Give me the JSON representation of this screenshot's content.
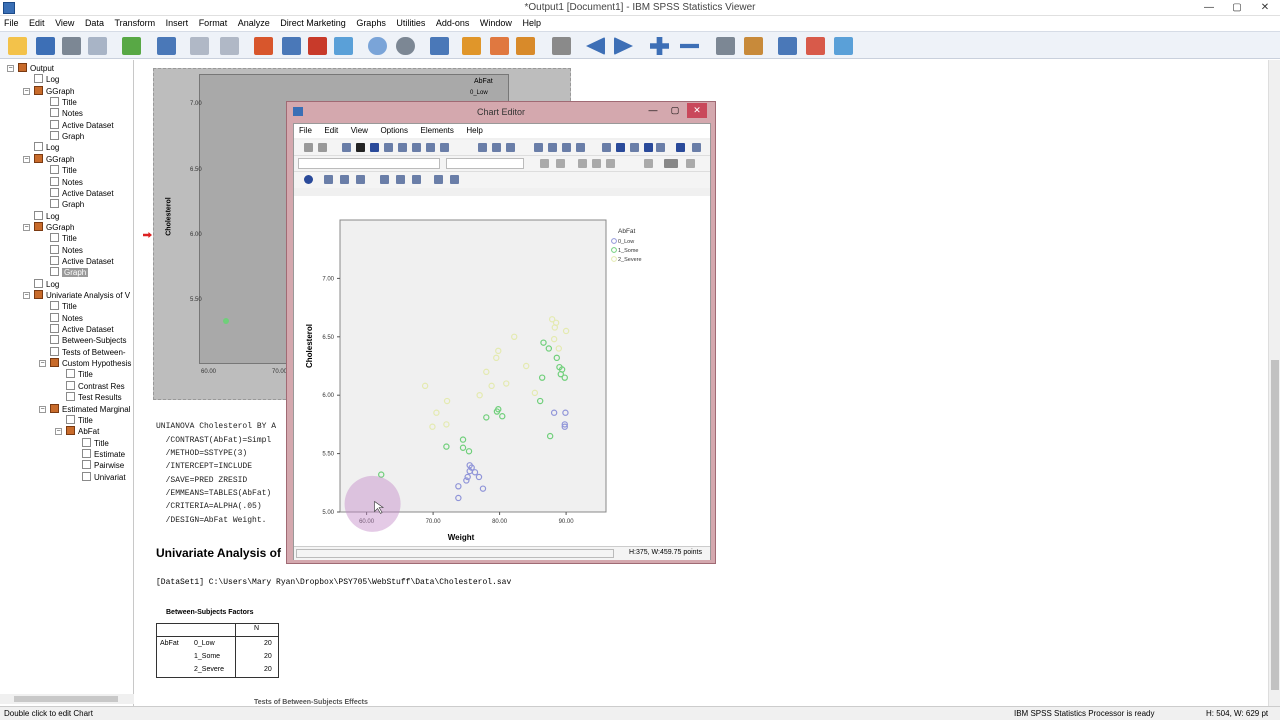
{
  "window": {
    "title": "*Output1 [Document1] - IBM SPSS Statistics Viewer",
    "min": "—",
    "max": "▢",
    "close": "✕"
  },
  "menu": [
    "File",
    "Edit",
    "View",
    "Data",
    "Transform",
    "Insert",
    "Format",
    "Analyze",
    "Direct Marketing",
    "Graphs",
    "Utilities",
    "Add-ons",
    "Window",
    "Help"
  ],
  "outline": [
    {
      "label": "Output",
      "level": 0,
      "icon": "book"
    },
    {
      "label": "Log",
      "level": 1,
      "icon": "doc"
    },
    {
      "label": "GGraph",
      "level": 1,
      "icon": "book"
    },
    {
      "label": "Title",
      "level": 2,
      "icon": "doc"
    },
    {
      "label": "Notes",
      "level": 2,
      "icon": "doc"
    },
    {
      "label": "Active Dataset",
      "level": 2,
      "icon": "doc"
    },
    {
      "label": "Graph",
      "level": 2,
      "icon": "doc"
    },
    {
      "label": "Log",
      "level": 1,
      "icon": "doc"
    },
    {
      "label": "GGraph",
      "level": 1,
      "icon": "book"
    },
    {
      "label": "Title",
      "level": 2,
      "icon": "doc"
    },
    {
      "label": "Notes",
      "level": 2,
      "icon": "doc"
    },
    {
      "label": "Active Dataset",
      "level": 2,
      "icon": "doc"
    },
    {
      "label": "Graph",
      "level": 2,
      "icon": "doc"
    },
    {
      "label": "Log",
      "level": 1,
      "icon": "doc"
    },
    {
      "label": "GGraph",
      "level": 1,
      "icon": "book"
    },
    {
      "label": "Title",
      "level": 2,
      "icon": "doc"
    },
    {
      "label": "Notes",
      "level": 2,
      "icon": "doc"
    },
    {
      "label": "Active Dataset",
      "level": 2,
      "icon": "doc"
    },
    {
      "label": "Graph",
      "level": 2,
      "icon": "doc",
      "selected": true
    },
    {
      "label": "Log",
      "level": 1,
      "icon": "doc"
    },
    {
      "label": "Univariate Analysis of V",
      "level": 1,
      "icon": "book"
    },
    {
      "label": "Title",
      "level": 2,
      "icon": "doc"
    },
    {
      "label": "Notes",
      "level": 2,
      "icon": "doc"
    },
    {
      "label": "Active Dataset",
      "level": 2,
      "icon": "doc"
    },
    {
      "label": "Between-Subjects",
      "level": 2,
      "icon": "doc"
    },
    {
      "label": "Tests of Between-",
      "level": 2,
      "icon": "doc"
    },
    {
      "label": "Custom Hypothesis",
      "level": 2,
      "icon": "book"
    },
    {
      "label": "Title",
      "level": 3,
      "icon": "doc"
    },
    {
      "label": "Contrast Res",
      "level": 3,
      "icon": "doc"
    },
    {
      "label": "Test Results",
      "level": 3,
      "icon": "doc"
    },
    {
      "label": "Estimated Marginal",
      "level": 2,
      "icon": "book"
    },
    {
      "label": "Title",
      "level": 3,
      "icon": "doc"
    },
    {
      "label": "AbFat",
      "level": 3,
      "icon": "book"
    },
    {
      "label": "Title",
      "level": 4,
      "icon": "doc"
    },
    {
      "label": "Estimate",
      "level": 4,
      "icon": "doc"
    },
    {
      "label": "Pairwise",
      "level": 4,
      "icon": "doc"
    },
    {
      "label": "Univariat",
      "level": 4,
      "icon": "doc"
    }
  ],
  "bgchart": {
    "ylabel": "Cholesterol",
    "yticks": [
      "7.00",
      "6.50",
      "6.00",
      "5.50"
    ],
    "xticks": [
      "60.00",
      "70.00"
    ],
    "legend_title": "AbFat",
    "legend_first": "0_Low"
  },
  "syntax": [
    "UNIANOVA Cholesterol BY A",
    "  /CONTRAST(AbFat)=Simpl",
    "  /METHOD=SSTYPE(3)",
    "  /INTERCEPT=INCLUDE",
    "  /SAVE=PRED ZRESID",
    "  /EMMEANS=TABLES(AbFat)",
    "  /CRITERIA=ALPHA(.05)",
    "  /DESIGN=AbFat Weight."
  ],
  "uv_title": "Univariate Analysis of",
  "dataset_line": "[DataSet1] C:\\Users\\Mary Ryan\\Dropbox\\PSY705\\WebStuff\\Data\\Cholesterol.sav",
  "bsf": {
    "title": "Between-Subjects Factors",
    "n_header": "N",
    "factor": "AbFat",
    "rows": [
      {
        "level": "0_Low",
        "n": "20"
      },
      {
        "level": "1_Some",
        "n": "20"
      },
      {
        "level": "2_Severe",
        "n": "20"
      }
    ]
  },
  "tests_title": "Tests of Between-Subjects Effects",
  "status": {
    "left": "Double click to edit Chart",
    "processor": "IBM SPSS Statistics Processor is ready",
    "dims": "H: 504, W: 629 pt"
  },
  "chart_editor": {
    "title": "Chart Editor",
    "menu": [
      "File",
      "Edit",
      "View",
      "Options",
      "Elements",
      "Help"
    ],
    "status": "H:375, W:459.75 points"
  },
  "chart_data": {
    "type": "scatter",
    "xlabel": "Weight",
    "ylabel": "Cholesterol",
    "xlim": [
      56,
      96
    ],
    "ylim": [
      5.0,
      7.5
    ],
    "xticks": [
      "60.00",
      "70.00",
      "80.00",
      "90.00"
    ],
    "yticks": [
      "5.00",
      "5.50",
      "6.00",
      "6.50",
      "7.00"
    ],
    "legend_title": "AbFat",
    "series": [
      {
        "name": "0_Low",
        "color": "#8f94d8",
        "points": [
          [
            73.8,
            5.12
          ],
          [
            73.8,
            5.22
          ],
          [
            75.0,
            5.27
          ],
          [
            75.5,
            5.35
          ],
          [
            75.8,
            5.38
          ],
          [
            75.2,
            5.3
          ],
          [
            76.3,
            5.34
          ],
          [
            76.9,
            5.3
          ],
          [
            77.5,
            5.2
          ],
          [
            75.5,
            5.4
          ],
          [
            88.2,
            5.85
          ],
          [
            89.8,
            5.75
          ],
          [
            89.9,
            5.85
          ],
          [
            89.8,
            5.73
          ]
        ]
      },
      {
        "name": "1_Some",
        "color": "#6fcf7a",
        "points": [
          [
            62.2,
            5.32
          ],
          [
            72.0,
            5.56
          ],
          [
            74.5,
            5.62
          ],
          [
            74.5,
            5.55
          ],
          [
            75.4,
            5.52
          ],
          [
            78.0,
            5.81
          ],
          [
            79.6,
            5.86
          ],
          [
            80.4,
            5.82
          ],
          [
            79.8,
            5.88
          ],
          [
            86.1,
            5.95
          ],
          [
            86.4,
            6.15
          ],
          [
            86.6,
            6.45
          ],
          [
            89.0,
            6.24
          ],
          [
            88.6,
            6.32
          ],
          [
            89.2,
            6.18
          ],
          [
            89.4,
            6.22
          ],
          [
            87.4,
            6.4
          ],
          [
            87.6,
            5.65
          ],
          [
            89.8,
            6.15
          ]
        ]
      },
      {
        "name": "2_Severe",
        "color": "#e4eab0",
        "points": [
          [
            68.8,
            6.08
          ],
          [
            69.9,
            5.73
          ],
          [
            70.5,
            5.85
          ],
          [
            72.0,
            5.75
          ],
          [
            72.1,
            5.95
          ],
          [
            79.8,
            6.38
          ],
          [
            79.5,
            6.32
          ],
          [
            78.8,
            6.08
          ],
          [
            81.0,
            6.1
          ],
          [
            82.2,
            6.5
          ],
          [
            84.0,
            6.25
          ],
          [
            85.3,
            6.02
          ],
          [
            88.5,
            6.62
          ],
          [
            87.9,
            6.65
          ],
          [
            88.2,
            6.48
          ],
          [
            90.0,
            6.55
          ],
          [
            88.9,
            6.4
          ],
          [
            88.3,
            6.58
          ],
          [
            77.0,
            6.0
          ],
          [
            78.0,
            6.2
          ]
        ]
      }
    ]
  }
}
